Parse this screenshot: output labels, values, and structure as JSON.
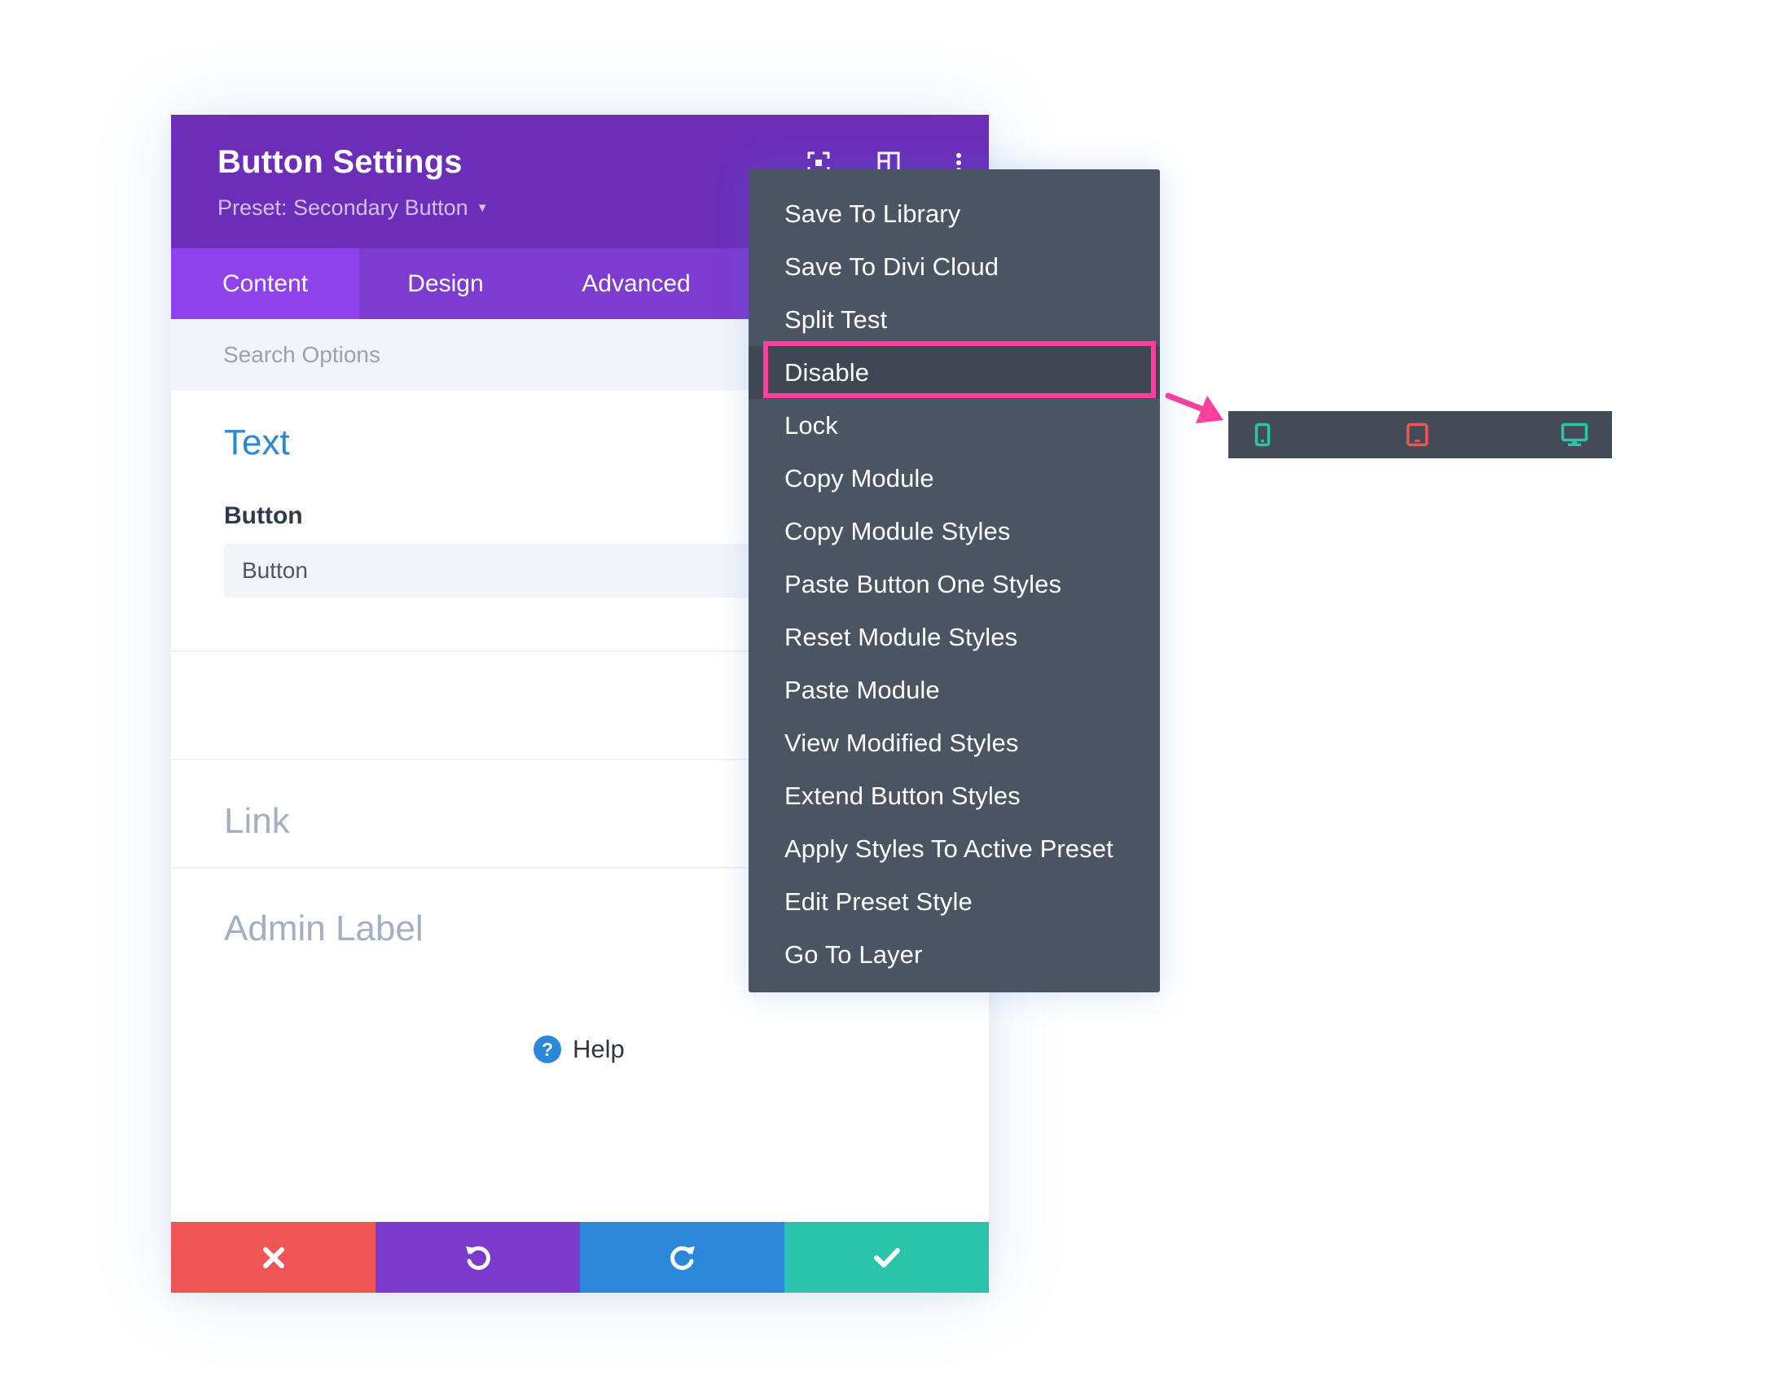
{
  "panel": {
    "title": "Button Settings",
    "preset": "Preset: Secondary Button",
    "header_icons": [
      "focus-mode-icon",
      "split-view-icon",
      "more-options-icon"
    ],
    "tabs": [
      {
        "label": "Content",
        "active": true
      },
      {
        "label": "Design",
        "active": false
      },
      {
        "label": "Advanced",
        "active": false
      }
    ],
    "search_placeholder": "Search Options",
    "sections": {
      "text": {
        "title": "Text",
        "field_label": "Button",
        "field_value": "Button"
      },
      "link": {
        "title": "Link"
      },
      "admin_label": {
        "title": "Admin Label"
      }
    },
    "help_label": "Help",
    "footer_buttons": [
      {
        "name": "discard",
        "icon": "close-icon",
        "color": "#ef5555"
      },
      {
        "name": "undo",
        "icon": "undo-icon",
        "color": "#7b3acc"
      },
      {
        "name": "redo",
        "icon": "redo-icon",
        "color": "#2b87da"
      },
      {
        "name": "save",
        "icon": "checkmark-icon",
        "color": "#29c4a9"
      }
    ]
  },
  "menu": {
    "items": [
      "Save To Library",
      "Save To Divi Cloud",
      "Split Test",
      "Disable",
      "Lock",
      "Copy Module",
      "Copy Module Styles",
      "Paste Button One Styles",
      "Reset Module Styles",
      "Paste Module",
      "View Modified Styles",
      "Extend Button Styles",
      "Apply Styles To Active Preset",
      "Edit Preset Style",
      "Go To Layer"
    ],
    "highlighted_item": "Disable"
  },
  "device_toggle": {
    "devices": [
      {
        "name": "phone",
        "icon": "phone-icon",
        "color": "#29c4a9",
        "disabled": false
      },
      {
        "name": "tablet",
        "icon": "tablet-icon",
        "color": "#ef5555",
        "disabled": true
      },
      {
        "name": "desktop",
        "icon": "desktop-icon",
        "color": "#29c4a9",
        "disabled": false
      }
    ]
  },
  "colors": {
    "header": "#6c2eb9",
    "tab_bar": "#7e3bd0",
    "active_tab": "#8f42ec",
    "menu_bg": "#4a5463",
    "highlight": "#ff3e9d",
    "section_active": "#2b87da",
    "section_inactive": "#a2b0c1"
  }
}
